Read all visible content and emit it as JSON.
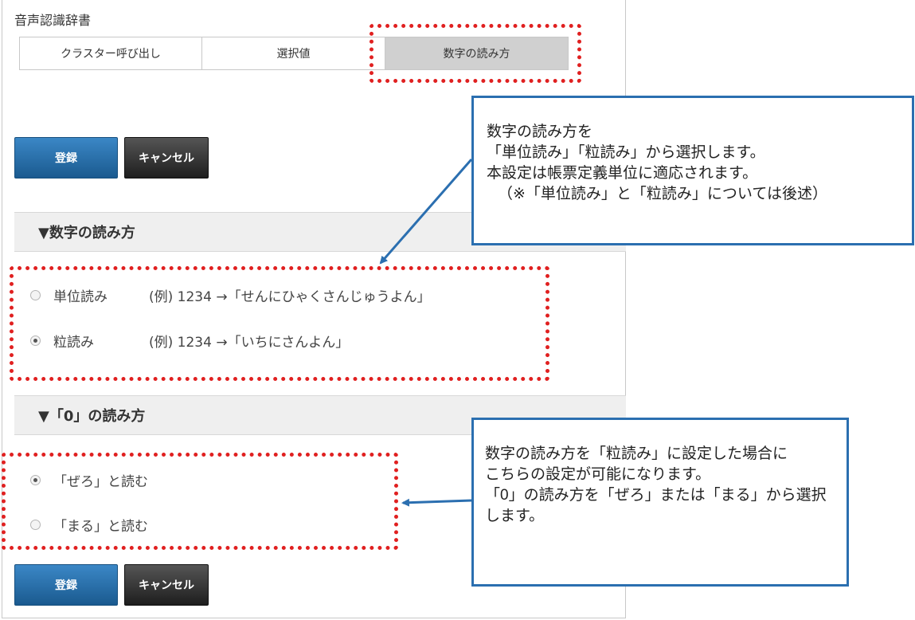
{
  "app": {
    "title": "音声認識辞書"
  },
  "tabs": [
    {
      "label": "クラスター呼び出し",
      "active": false
    },
    {
      "label": "選択値",
      "active": false
    },
    {
      "label": "数字の読み方",
      "active": true
    }
  ],
  "buttons": {
    "register": "登録",
    "cancel": "キャンセル"
  },
  "sections": {
    "number_reading": {
      "heading": "▼数字の読み方",
      "options": [
        {
          "label": "単位読み",
          "example": "(例) 1234 →「せんにひゃくさんじゅうよん」",
          "checked": false
        },
        {
          "label": "粒読み",
          "example": "(例) 1234 →「いちにさんよん」",
          "checked": true
        }
      ]
    },
    "zero_reading": {
      "heading": "▼「0」の読み方",
      "options": [
        {
          "label": "「ぜろ」と読む",
          "checked": true
        },
        {
          "label": "「まる」と読む",
          "checked": false
        }
      ]
    }
  },
  "callouts": {
    "top": [
      "数字の読み方を",
      "「単位読み」「粒読み」から選択します。",
      "本設定は帳票定義単位に適応されます。",
      "（※「単位読み」と「粒読み」については後述）"
    ],
    "bottom": [
      "数字の読み方を「粒読み」に設定した場合に",
      "こちらの設定が可能になります。",
      "「0」の読み方を「ぜろ」または「まる」から選択",
      "します。"
    ]
  },
  "colors": {
    "highlight": "#e02020",
    "callout_border": "#2b6fb0",
    "primary_button": "#1f6aa5"
  }
}
